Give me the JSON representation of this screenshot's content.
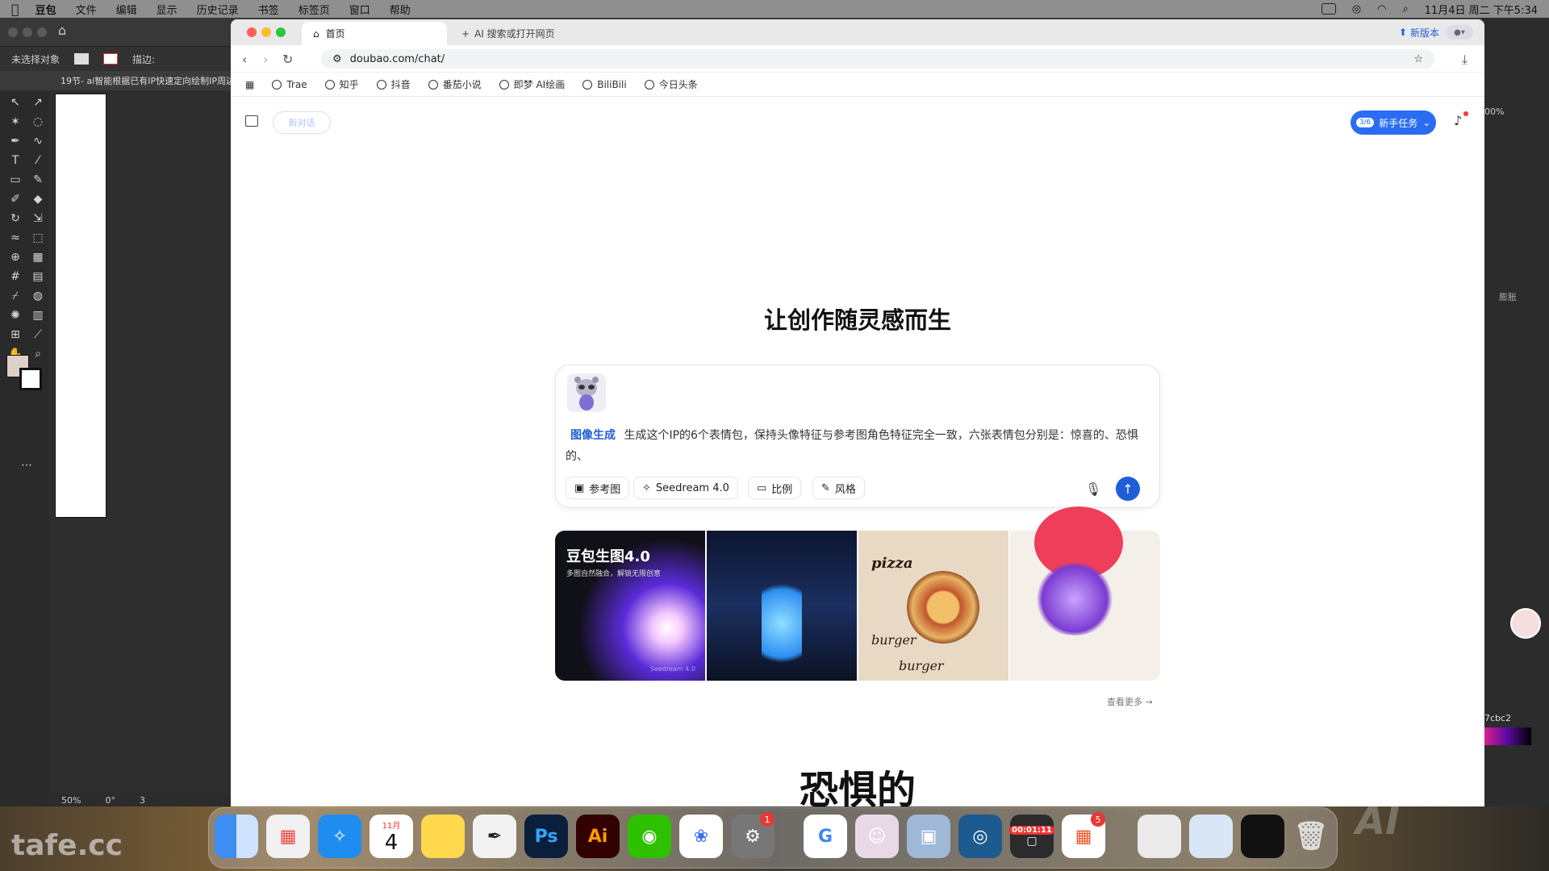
{
  "menubar": {
    "app": "豆包",
    "items": [
      "文件",
      "编辑",
      "显示",
      "历史记录",
      "书签",
      "标签页",
      "窗口",
      "帮助"
    ],
    "clock": "11月4日 周二 下午5:34"
  },
  "illustrator": {
    "selection": "未选择对象",
    "stroke_label": "描边:",
    "doc_tab": "19节- ai智能根据已有IP快速定向绘制IP周边",
    "zoom": "50%",
    "rotation": "0°",
    "artboard": "3",
    "color_hex": "7cbc2",
    "right_label": "膨胀",
    "right_zoom": "00%"
  },
  "browser": {
    "active_tab": "首页",
    "new_tab": "AI 搜索或打开网页",
    "new_version": "新版本",
    "url": "doubao.com/chat/",
    "bookmarks": [
      "Trae",
      "知乎",
      "抖音",
      "番茄小说",
      "即梦 AI绘画",
      "BiliBili",
      "今日头条"
    ]
  },
  "page": {
    "new_chat": "新对话",
    "task_count": "3/6",
    "task_label": "新手任务",
    "headline": "让创作随灵感而生",
    "prompt_tag": "图像生成",
    "prompt_text": "生成这个IP的6个表情包，保持头像特征与参考图角色特征完全一致，六张表情包分别是：惊喜的、恐惧的、",
    "chips": [
      "参考图",
      "Seedream 4.0",
      "比例",
      "风格"
    ],
    "gallery": {
      "title": "豆包生图4.0",
      "subtitle": "多图自然融合，解锁无限创意",
      "mark": "Seedream 4.0",
      "pizza_word": "pizza",
      "burger_word": "burger",
      "burger_word2": "burger"
    },
    "see_more": "查看更多 →",
    "subtitle_caption": "恐惧的"
  },
  "dock": {
    "calendar_month": "11月",
    "calendar_day": "4",
    "badge_settings": "1",
    "badge_office": "5",
    "timer": "00:01:11",
    "ps_label": "Ps",
    "ai_label": "Ai",
    "watermark": "tafe.cc",
    "watermark2": "AI"
  }
}
